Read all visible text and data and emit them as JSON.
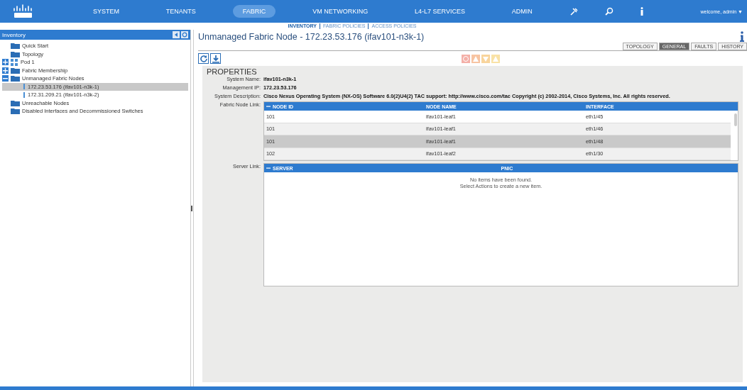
{
  "top_nav": {
    "items": [
      {
        "label": "SYSTEM",
        "selected": false
      },
      {
        "label": "TENANTS",
        "selected": false
      },
      {
        "label": "FABRIC",
        "selected": true
      },
      {
        "label": "VM NETWORKING",
        "selected": false
      },
      {
        "label": "L4-L7 SERVICES",
        "selected": false
      },
      {
        "label": "ADMIN",
        "selected": false
      }
    ],
    "user": "welcome, admin ▼"
  },
  "sub_nav": [
    {
      "label": "INVENTORY",
      "selected": true
    },
    {
      "label": "FABRIC POLICIES",
      "selected": false
    },
    {
      "label": "ACCESS POLICIES",
      "selected": false
    }
  ],
  "sidebar": {
    "title": "Inventory",
    "items": [
      {
        "label": "Quick Start",
        "kind": "folder"
      },
      {
        "label": "Topology",
        "kind": "folder"
      },
      {
        "label": "Pod 1",
        "kind": "pod",
        "expanded": false
      },
      {
        "label": "Fabric Membership",
        "kind": "folder",
        "expanded": false
      },
      {
        "label": "Unmanaged Fabric Nodes",
        "kind": "folder",
        "expanded": true,
        "children": [
          {
            "label": "172.23.53.176 (ifav101-n3k-1)",
            "kind": "node",
            "selected": true
          },
          {
            "label": "172.31.209.21 (ifav101-n3k-2)",
            "kind": "node",
            "selected": false
          }
        ]
      },
      {
        "label": "Unreachable Nodes",
        "kind": "folder"
      },
      {
        "label": "Disabled Interfaces and Decommissioned Switches",
        "kind": "folder"
      }
    ]
  },
  "page": {
    "title": "Unmanaged Fabric Node - 172.23.53.176 (ifav101-n3k-1)",
    "tabs": [
      {
        "label": "TOPOLOGY",
        "selected": false
      },
      {
        "label": "GENERAL",
        "selected": true
      },
      {
        "label": "FAULTS",
        "selected": false
      },
      {
        "label": "HISTORY",
        "selected": false
      }
    ],
    "section": "PROPERTIES",
    "properties": [
      {
        "label": "System Name:",
        "value": "ifav101-n3k-1"
      },
      {
        "label": "Management IP:",
        "value": "172.23.53.176"
      },
      {
        "label": "System Description:",
        "value": "Cisco Nexus Operating System (NX-OS) Software 6.0(2)U4(2) TAC support: http://www.cisco.com/tac Copyright (c) 2002-2014, Cisco Systems, Inc. All rights reserved."
      }
    ],
    "fabric_node_link": {
      "label": "Fabric Node Link:",
      "columns": [
        "NODE ID",
        "NODE NAME",
        "INTERFACE"
      ],
      "rows": [
        {
          "cells": [
            "101",
            "ifav101-leaf1",
            "eth1/45"
          ],
          "selected": false
        },
        {
          "cells": [
            "101",
            "ifav101-leaf1",
            "eth1/46"
          ],
          "selected": false
        },
        {
          "cells": [
            "101",
            "ifav101-leaf1",
            "eth1/48"
          ],
          "selected": true
        },
        {
          "cells": [
            "102",
            "ifav101-leaf2",
            "eth1/30"
          ],
          "selected": false
        }
      ]
    },
    "server_link": {
      "label": "Server Link:",
      "columns": [
        "SERVER",
        "PNIC"
      ],
      "empty_message": [
        "No items have been found.",
        "Select Actions to create a new item."
      ]
    }
  }
}
